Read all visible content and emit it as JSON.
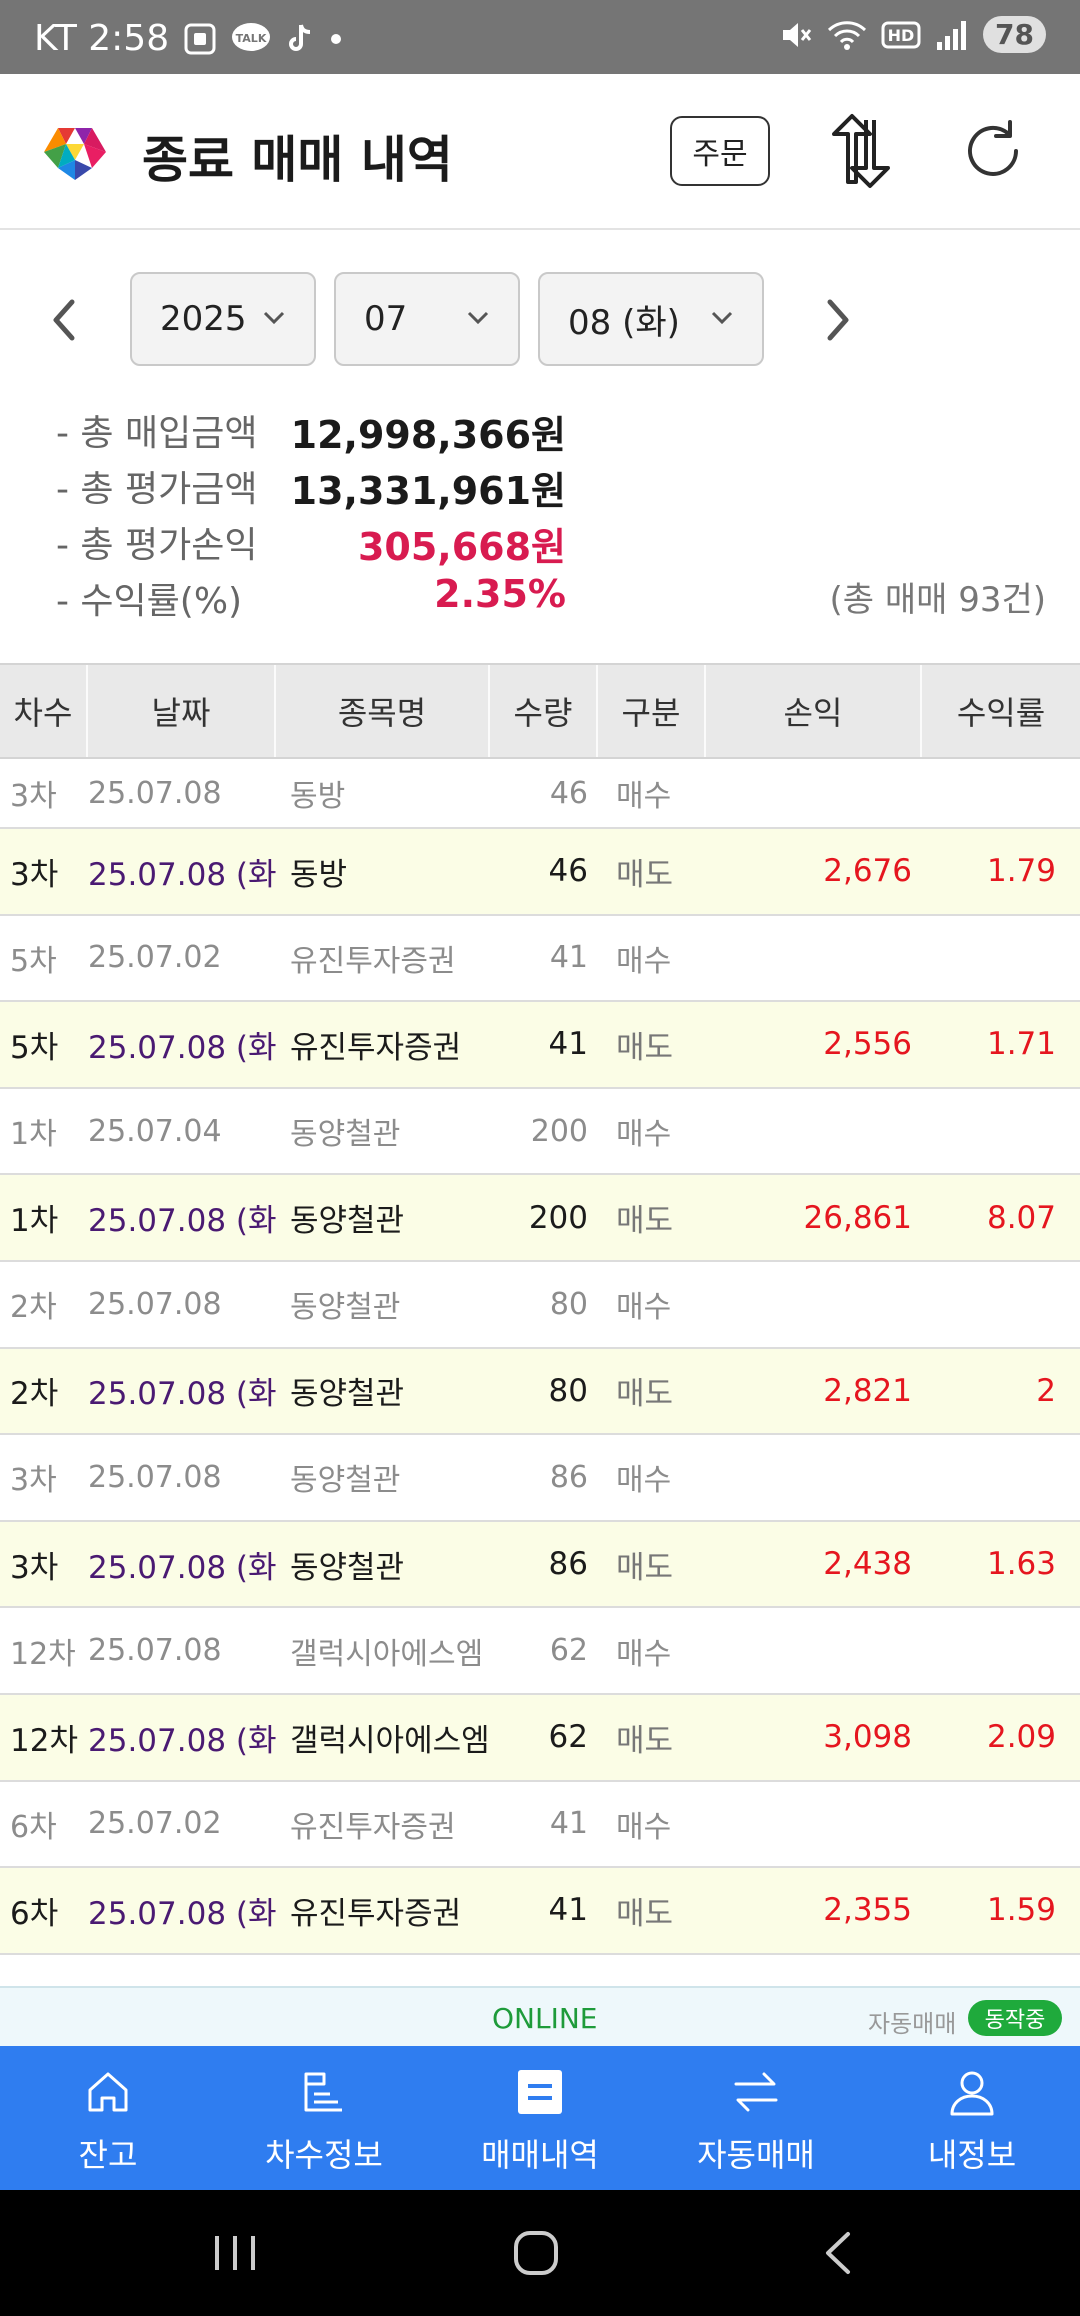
{
  "status_bar": {
    "carrier": "KT",
    "time": "2:58",
    "talk_badge": "TALK",
    "hd_badge": "HD",
    "battery": "78"
  },
  "header": {
    "title": "종료 매매 내역",
    "order_button": "주문"
  },
  "date_selector": {
    "year": "2025",
    "month": "07",
    "day": "08 (화)"
  },
  "summary": {
    "total_buy_label": "- 총 매입금액",
    "total_buy_value": "12,998,366원",
    "total_eval_label": "- 총 평가금액",
    "total_eval_value": "13,331,961원",
    "total_pl_label": "- 총 평가손익",
    "total_pl_value": "305,668원",
    "return_label": "- 수익률(%)",
    "return_value": "2.35%",
    "trade_count": "(총 매매 93건)"
  },
  "table": {
    "headers": [
      "차수",
      "날짜",
      "종목명",
      "수량",
      "구분",
      "손익",
      "수익률"
    ],
    "rows": [
      {
        "type": "buy",
        "round": "3차",
        "date": "25.07.08",
        "name": "동방",
        "qty": "46",
        "side": "매수",
        "pl": "",
        "rate": ""
      },
      {
        "type": "sell",
        "round": "3차",
        "date": "25.07.08 (화)",
        "name": "동방",
        "qty": "46",
        "side": "매도",
        "pl": "2,676",
        "rate": "1.79"
      },
      {
        "type": "buy",
        "round": "5차",
        "date": "25.07.02",
        "name": "유진투자증권",
        "qty": "41",
        "side": "매수",
        "pl": "",
        "rate": ""
      },
      {
        "type": "sell",
        "round": "5차",
        "date": "25.07.08 (화)",
        "name": "유진투자증권",
        "qty": "41",
        "side": "매도",
        "pl": "2,556",
        "rate": "1.71"
      },
      {
        "type": "buy",
        "round": "1차",
        "date": "25.07.04",
        "name": "동양철관",
        "qty": "200",
        "side": "매수",
        "pl": "",
        "rate": ""
      },
      {
        "type": "sell",
        "round": "1차",
        "date": "25.07.08 (화)",
        "name": "동양철관",
        "qty": "200",
        "side": "매도",
        "pl": "26,861",
        "rate": "8.07"
      },
      {
        "type": "buy",
        "round": "2차",
        "date": "25.07.08",
        "name": "동양철관",
        "qty": "80",
        "side": "매수",
        "pl": "",
        "rate": ""
      },
      {
        "type": "sell",
        "round": "2차",
        "date": "25.07.08 (화)",
        "name": "동양철관",
        "qty": "80",
        "side": "매도",
        "pl": "2,821",
        "rate": "2"
      },
      {
        "type": "buy",
        "round": "3차",
        "date": "25.07.08",
        "name": "동양철관",
        "qty": "86",
        "side": "매수",
        "pl": "",
        "rate": ""
      },
      {
        "type": "sell",
        "round": "3차",
        "date": "25.07.08 (화)",
        "name": "동양철관",
        "qty": "86",
        "side": "매도",
        "pl": "2,438",
        "rate": "1.63"
      },
      {
        "type": "buy",
        "round": "12차",
        "date": "25.07.08",
        "name": "갤럭시아에스엠",
        "qty": "62",
        "side": "매수",
        "pl": "",
        "rate": ""
      },
      {
        "type": "sell",
        "round": "12차",
        "date": "25.07.08 (화)",
        "name": "갤럭시아에스엠",
        "qty": "62",
        "side": "매도",
        "pl": "3,098",
        "rate": "2.09"
      },
      {
        "type": "buy",
        "round": "6차",
        "date": "25.07.02",
        "name": "유진투자증권",
        "qty": "41",
        "side": "매수",
        "pl": "",
        "rate": ""
      },
      {
        "type": "sell",
        "round": "6차",
        "date": "25.07.08 (화)",
        "name": "유진투자증권",
        "qty": "41",
        "side": "매도",
        "pl": "2,355",
        "rate": "1.59"
      }
    ]
  },
  "online_strip": {
    "status": "ONLINE",
    "auto_label": "자동매매",
    "auto_badge": "동작중"
  },
  "bottom_nav": {
    "items": [
      {
        "label": "잔고",
        "icon": "home-icon"
      },
      {
        "label": "차수정보",
        "icon": "rounds-icon"
      },
      {
        "label": "매매내역",
        "icon": "trade-history-icon"
      },
      {
        "label": "자동매매",
        "icon": "auto-trade-icon"
      },
      {
        "label": "내정보",
        "icon": "profile-icon"
      }
    ],
    "active_index": 2
  },
  "colors": {
    "accent": "#2f7df0",
    "loss_profit_red": "#e5161f",
    "summary_red": "#d81b50",
    "sell_row_bg": "#fbfde6",
    "online_green": "#1e9b3a"
  }
}
